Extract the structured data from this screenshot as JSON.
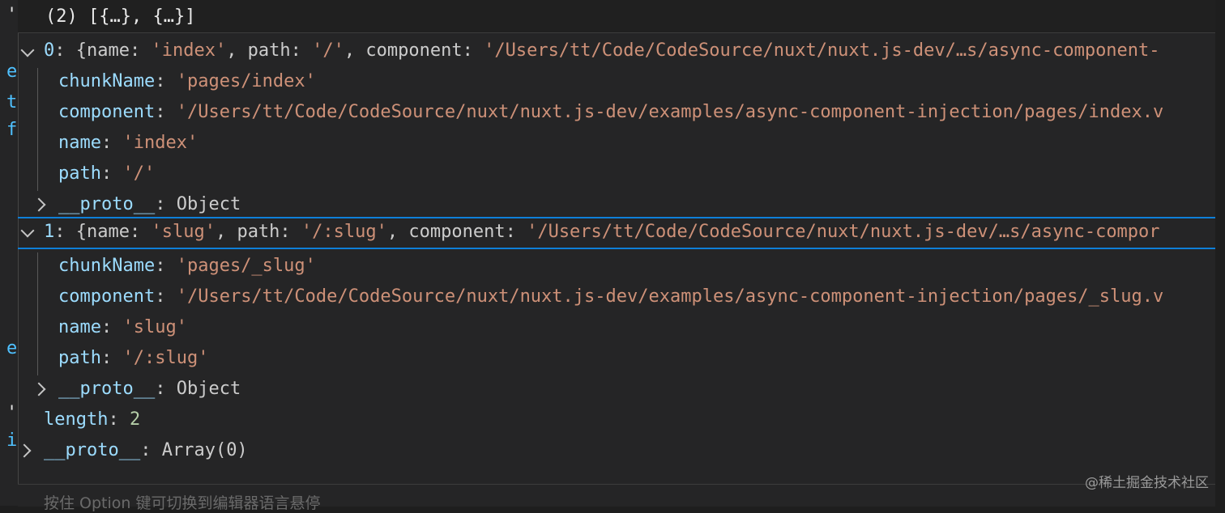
{
  "header": {
    "title": "(2) [{…}, {…}]"
  },
  "items": [
    {
      "index": "0",
      "summary_pre": "{name: ",
      "summary_name": "'index'",
      "summary_mid1": ", path: ",
      "summary_path": "'/'",
      "summary_mid2": ", component: ",
      "summary_component": "'/Users/tt/Code/CodeSource/nuxt/nuxt.js-dev/…s/async-component-",
      "chunkName_key": "chunkName",
      "chunkName_value": "'pages/index'",
      "component_key": "component",
      "component_value": "'/Users/tt/Code/CodeSource/nuxt/nuxt.js-dev/examples/async-component-injection/pages/index.v",
      "name_key": "name",
      "name_value": "'index'",
      "path_key": "path",
      "path_value": "'/'",
      "proto_key": "__proto__",
      "proto_value": "Object"
    },
    {
      "index": "1",
      "summary_pre": "{name: ",
      "summary_name": "'slug'",
      "summary_mid1": ", path: ",
      "summary_path": "'/:slug'",
      "summary_mid2": ", component: ",
      "summary_component": "'/Users/tt/Code/CodeSource/nuxt/nuxt.js-dev/…s/async-compor",
      "chunkName_key": "chunkName",
      "chunkName_value": "'pages/_slug'",
      "component_key": "component",
      "component_value": "'/Users/tt/Code/CodeSource/nuxt/nuxt.js-dev/examples/async-component-injection/pages/_slug.v",
      "name_key": "name",
      "name_value": "'slug'",
      "path_key": "path",
      "path_value": "'/:slug'",
      "proto_key": "__proto__",
      "proto_value": "Object"
    }
  ],
  "length": {
    "key": "length",
    "value": "2"
  },
  "array_proto": {
    "key": "__proto__",
    "value": "Array(0)"
  },
  "footer": {
    "hint": "按住 Option 键可切换到编辑器语言悬停"
  },
  "watermark": "@稀土掘金技术社区",
  "gutter_chars": [
    "'",
    "e",
    "t",
    "f",
    "e",
    "'",
    "i"
  ],
  "colors": {
    "key": "#9cdcfe",
    "string": "#ce9178",
    "number": "#b5cea8",
    "selection": "#0e7fd8"
  }
}
